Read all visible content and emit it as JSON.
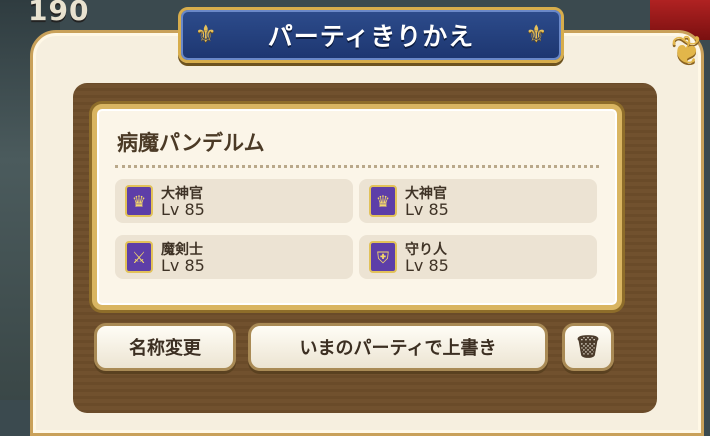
{
  "background": {
    "counter_text": "190"
  },
  "header": {
    "title": "パーティきりかえ"
  },
  "party": {
    "name": "病魔パンデルム",
    "members": [
      {
        "job": "大神官",
        "level": "Lv 85",
        "icon": "priest-icon"
      },
      {
        "job": "大神官",
        "level": "Lv 85",
        "icon": "priest-icon"
      },
      {
        "job": "魔剣士",
        "level": "Lv 85",
        "icon": "magic-swordsman-icon"
      },
      {
        "job": "守り人",
        "level": "Lv 85",
        "icon": "guardian-icon"
      }
    ]
  },
  "actions": {
    "rename_label": "名称変更",
    "overwrite_label": "いまのパーティで上書き",
    "delete_icon": "trash-icon"
  },
  "colors": {
    "banner": "#2d4c8c",
    "gold_trim": "#d7ad4c",
    "job_icon_bg": "#5d3ea8"
  }
}
